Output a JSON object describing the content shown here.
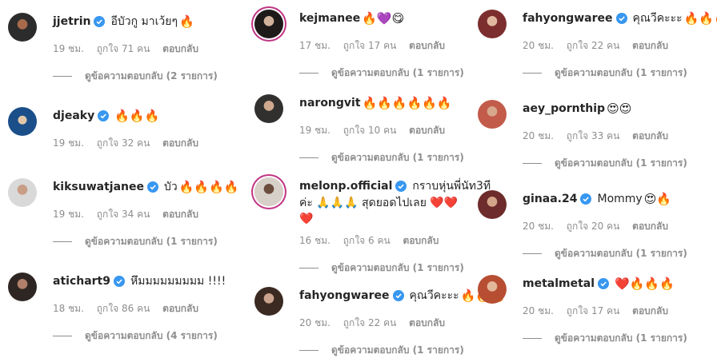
{
  "colors": {
    "verified": "#3897f0",
    "muted": "#8e8e8e",
    "text": "#262626"
  },
  "ui": {
    "time_unit": "ชม.",
    "likes_prefix": "ถูกใจ",
    "likes_suffix": "คน",
    "reply_label": "ตอบกลับ",
    "view_replies_prefix": "ดูข้อความตอบกลับ",
    "replies_unit": "รายการ"
  },
  "comments": [
    {
      "user": "jjetrin",
      "verified": true,
      "text": "อีบัวกู มาเว้ยๆ",
      "emoji": "🔥",
      "time": "19 ชม.",
      "likes": "ถูกใจ 71 คน",
      "reply": "ตอบกลับ",
      "view_replies": "ดูข้อความตอบกลับ (2 รายการ)"
    },
    {
      "user": "djeaky",
      "verified": true,
      "text": "",
      "emoji": "🔥🔥🔥",
      "time": "19 ชม.",
      "likes": "ถูกใจ 32 คน",
      "reply": "ตอบกลับ",
      "view_replies": ""
    },
    {
      "user": "kiksuwatjanee",
      "verified": true,
      "text": "บัว",
      "emoji": "🔥🔥🔥🔥",
      "time": "19 ชม.",
      "likes": "ถูกใจ 34 คน",
      "reply": "ตอบกลับ",
      "view_replies": "ดูข้อความตอบกลับ (1 รายการ)"
    },
    {
      "user": "atichart9",
      "verified": true,
      "text": "หึมมมมมมมมม !!!!",
      "emoji": "",
      "time": "18 ชม.",
      "likes": "ถูกใจ 86 คน",
      "reply": "ตอบกลับ",
      "view_replies": "ดูข้อความตอบกลับ (4 รายการ)"
    },
    {
      "user": "kejmanee",
      "verified": false,
      "text": "",
      "emoji": "🔥💜😋",
      "time": "17 ชม.",
      "likes": "ถูกใจ 17 คน",
      "reply": "ตอบกลับ",
      "view_replies": "ดูข้อความตอบกลับ (1 รายการ)"
    },
    {
      "user": "narongvit",
      "verified": false,
      "text": "",
      "emoji": "🔥🔥🔥🔥🔥🔥",
      "time": "19 ชม.",
      "likes": "ถูกใจ 10 คน",
      "reply": "ตอบกลับ",
      "view_replies": "ดูข้อความตอบกลับ (1 รายการ)"
    },
    {
      "user": "melonp.official",
      "verified": true,
      "text": "กราบหุ่นพี่นัท3ที",
      "text2": "ค่ะ 🙏🙏🙏 สุดยอดไปเลย ❤️❤️",
      "text3": "❤️",
      "emoji": "",
      "time": "16 ชม.",
      "likes": "ถูกใจ 6 คน",
      "reply": "ตอบกลับ",
      "view_replies": "ดูข้อความตอบกลับ (1 รายการ)"
    },
    {
      "user": "fahyongwaree",
      "verified": true,
      "text": "คุณวีคะะะ",
      "emoji": "🔥🔥🔥",
      "time": "20 ชม.",
      "likes": "ถูกใจ 22 คน",
      "reply": "ตอบกลับ",
      "view_replies": "ดูข้อความตอบกลับ (1 รายการ)"
    },
    {
      "user": "fahyongwaree",
      "verified": true,
      "text": "คุณวีคะะะ",
      "emoji": "🔥🔥🔥",
      "time": "20 ชม.",
      "likes": "ถูกใจ 22 คน",
      "reply": "ตอบกลับ",
      "view_replies": "ดูข้อความตอบกลับ (1 รายการ)"
    },
    {
      "user": "aey_pornthip",
      "verified": false,
      "text": "",
      "emoji": "😍😍",
      "time": "20 ชม.",
      "likes": "ถูกใจ 33 คน",
      "reply": "ตอบกลับ",
      "view_replies": "ดูข้อความตอบกลับ (1 รายการ)"
    },
    {
      "user": "ginaa.24",
      "verified": true,
      "text": "Mommy",
      "emoji": "😍🔥",
      "time": "20 ชม.",
      "likes": "ถูกใจ 20 คน",
      "reply": "ตอบกลับ",
      "view_replies": "ดูข้อความตอบกลับ (1 รายการ)"
    },
    {
      "user": "metalmetal",
      "verified": true,
      "text": "",
      "emoji": "❤️🔥🔥🔥",
      "time": "20 ชม.",
      "likes": "ถูกใจ 17 คน",
      "reply": "ตอบกลับ",
      "view_replies": "ดูข้อความตอบกลับ (1 รายการ)"
    }
  ]
}
